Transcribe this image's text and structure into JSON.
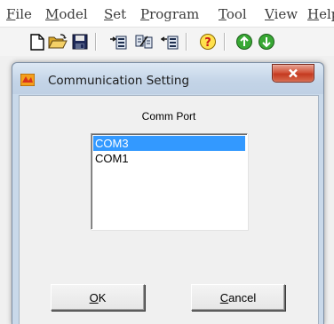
{
  "menu": {
    "items": [
      {
        "label": "File",
        "mnemonic": "F",
        "rest": "ile"
      },
      {
        "label": "Model",
        "mnemonic": "M",
        "rest": "odel"
      },
      {
        "label": "Set",
        "mnemonic": "S",
        "rest": "et"
      },
      {
        "label": "Program",
        "mnemonic": "P",
        "rest": "rogram"
      },
      {
        "label": "Tool",
        "mnemonic": "T",
        "rest": "ool"
      },
      {
        "label": "View",
        "mnemonic": "V",
        "rest": "iew"
      },
      {
        "label": "Help",
        "mnemonic": "H",
        "rest": "elp"
      }
    ]
  },
  "toolbar": {
    "icons": [
      "new-file-icon",
      "open-folder-icon",
      "save-icon",
      "download-to-plc-icon",
      "compare-icon",
      "upload-from-plc-icon",
      "help-icon",
      "run-icon",
      "stop-icon"
    ]
  },
  "dialog": {
    "title": "Communication Setting",
    "comm_port_label": "Comm Port",
    "ports": [
      "COM3",
      "COM1"
    ],
    "selected_port": "COM3",
    "ok": {
      "mnemonic": "O",
      "rest": "K"
    },
    "cancel": {
      "mnemonic": "C",
      "rest": "ancel"
    }
  },
  "colors": {
    "selection": "#3399ff",
    "close_button": "#c94b30",
    "title_bar": "#c9d9ea"
  }
}
